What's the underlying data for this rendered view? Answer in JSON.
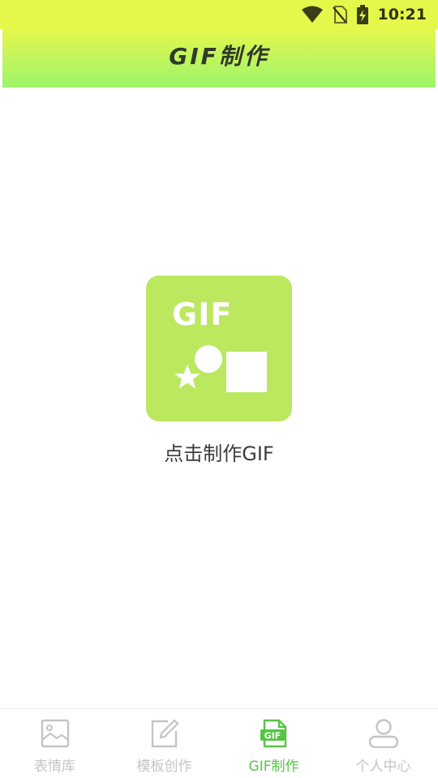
{
  "status_bar": {
    "time": "10:21",
    "icons": [
      "wifi-icon",
      "no-sim-icon",
      "battery-charging-icon"
    ],
    "color": "#e4f74a"
  },
  "header": {
    "title": "GIF制作"
  },
  "main": {
    "tile_text": "GIF",
    "caption": "点击制作GIF",
    "tile_color": "#bbe85f"
  },
  "bottom_nav": {
    "active_color": "#57c446",
    "inactive_color": "#c4c4c4",
    "items": [
      {
        "label": "表情库",
        "icon": "image-icon"
      },
      {
        "label": "模板创作",
        "icon": "edit-icon"
      },
      {
        "label": "GIF制作",
        "icon": "gif-file-icon"
      },
      {
        "label": "个人中心",
        "icon": "user-icon"
      }
    ]
  }
}
